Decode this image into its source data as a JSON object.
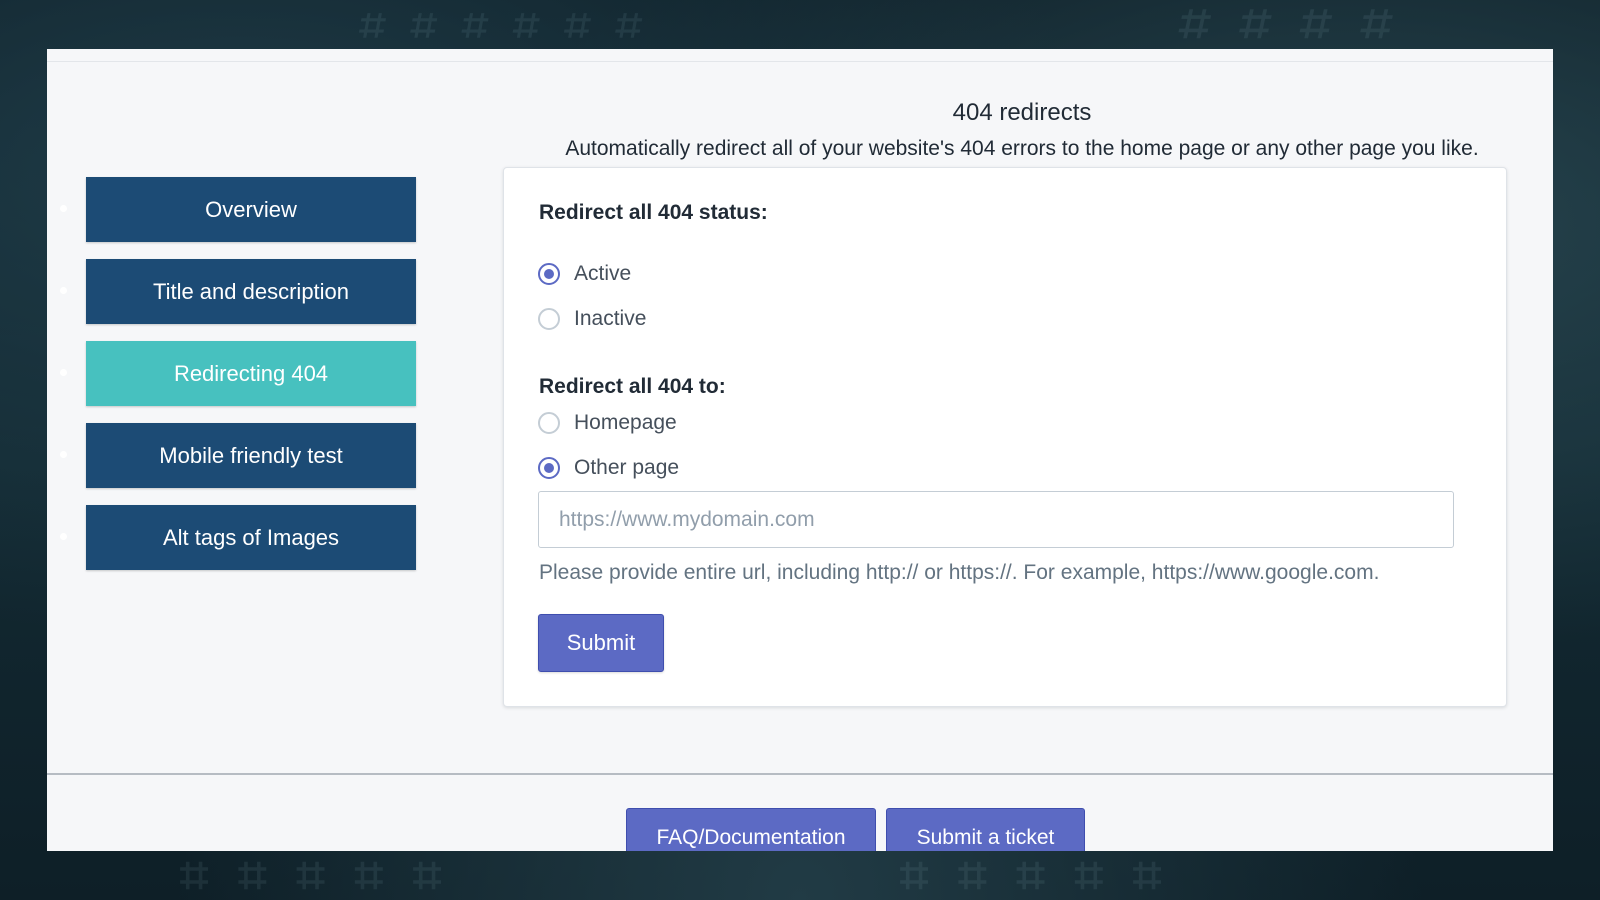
{
  "sidebar": {
    "items": [
      {
        "label": "Overview",
        "active": false
      },
      {
        "label": "Title and description",
        "active": false
      },
      {
        "label": "Redirecting 404",
        "active": true
      },
      {
        "label": "Mobile friendly test",
        "active": false
      },
      {
        "label": "Alt tags of Images",
        "active": false
      }
    ]
  },
  "header": {
    "title": "404 redirects",
    "subtitle": "Automatically redirect all of your website's 404 errors to the home page or any other page you like."
  },
  "form": {
    "status_label": "Redirect all 404 status:",
    "status_options": [
      {
        "label": "Active",
        "checked": true
      },
      {
        "label": "Inactive",
        "checked": false
      }
    ],
    "target_label": "Redirect all 404 to:",
    "target_options": [
      {
        "label": "Homepage",
        "checked": false
      },
      {
        "label": "Other page",
        "checked": true
      }
    ],
    "url_placeholder": "https://www.mydomain.com",
    "url_value": "",
    "help_text": "Please provide entire url, including http:// or https://. For example, https://www.google.com.",
    "submit_label": "Submit"
  },
  "footer": {
    "faq_label": "FAQ/Documentation",
    "ticket_label": "Submit a ticket"
  },
  "colors": {
    "nav_default": "#1c4b75",
    "nav_active": "#47c1bf",
    "primary": "#5c6ac4"
  }
}
